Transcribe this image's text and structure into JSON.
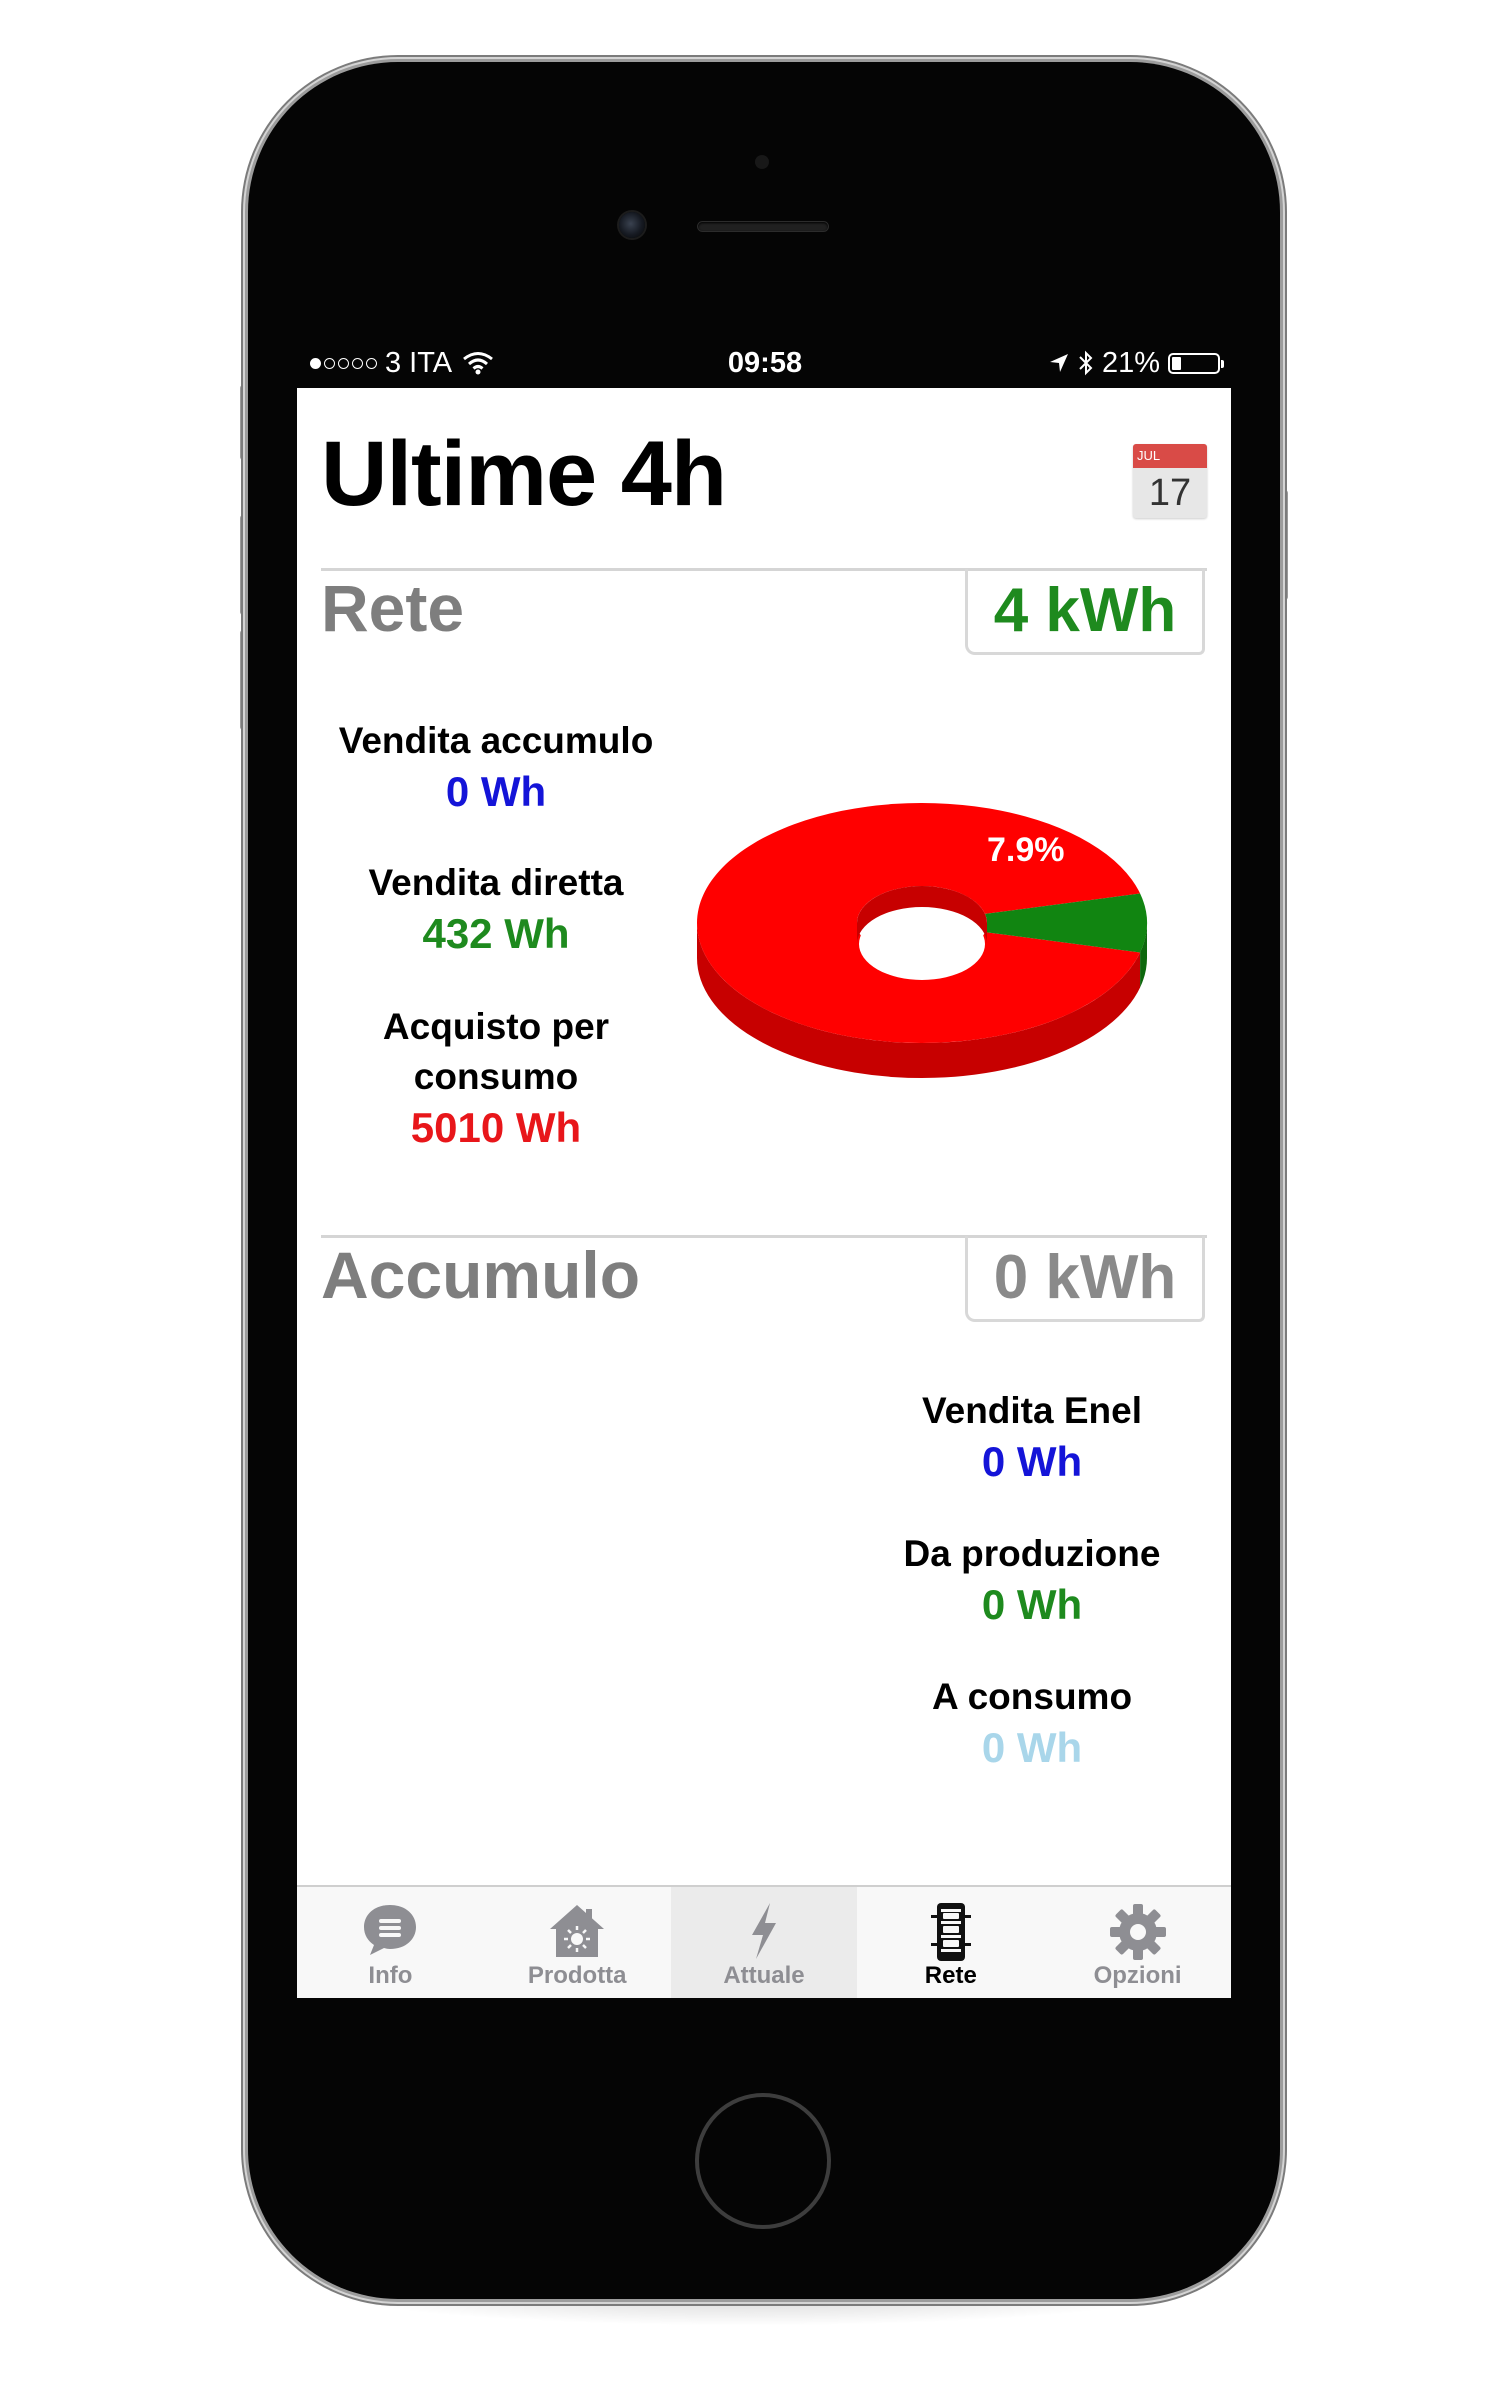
{
  "status_bar": {
    "carrier": "3 ITA",
    "time": "09:58",
    "battery_percent": "21%",
    "battery_level": 0.21,
    "signal_bars": 1,
    "icons": [
      "wifi-icon",
      "location-arrow-icon",
      "bluetooth-icon",
      "battery-icon"
    ]
  },
  "header": {
    "title": "Ultime 4h",
    "calendar": {
      "month": "JUL",
      "day": "17"
    }
  },
  "rete": {
    "title": "Rete",
    "total": "4 kWh",
    "total_color": "#1e8a1e",
    "stats": [
      {
        "label": "Vendita accumulo",
        "value": "0 Wh",
        "color": "blue"
      },
      {
        "label": "Vendita diretta",
        "value": "432 Wh",
        "color": "green"
      },
      {
        "label_line1": "Acquisto per",
        "label_line2": "consumo",
        "value": "5010 Wh",
        "color": "red"
      }
    ]
  },
  "chart_data": {
    "type": "pie",
    "style": "3d-donut",
    "slices": [
      {
        "label": "92.1%",
        "value": 92.1,
        "color": "#ff0000"
      },
      {
        "label": "7.9%",
        "value": 7.9,
        "color": "#118511"
      }
    ]
  },
  "accumulo": {
    "title": "Accumulo",
    "total": "0 kWh",
    "total_color": "#8a8a8a",
    "stats": [
      {
        "label": "Vendita Enel",
        "value": "0 Wh",
        "color": "blue"
      },
      {
        "label": "Da produzione",
        "value": "0 Wh",
        "color": "green"
      },
      {
        "label": "A consumo",
        "value": "0 Wh",
        "color": "lightblue"
      }
    ]
  },
  "tabbar": {
    "tabs": [
      {
        "label": "Info",
        "icon": "chat-bubble-icon"
      },
      {
        "label": "Prodotta",
        "icon": "solar-house-icon"
      },
      {
        "label": "Attuale",
        "icon": "lightning-bolt-icon"
      },
      {
        "label": "Rete",
        "icon": "power-pylon-icon"
      },
      {
        "label": "Opzioni",
        "icon": "gear-icon"
      }
    ],
    "selected": "Rete",
    "highlighted": "Attuale"
  }
}
